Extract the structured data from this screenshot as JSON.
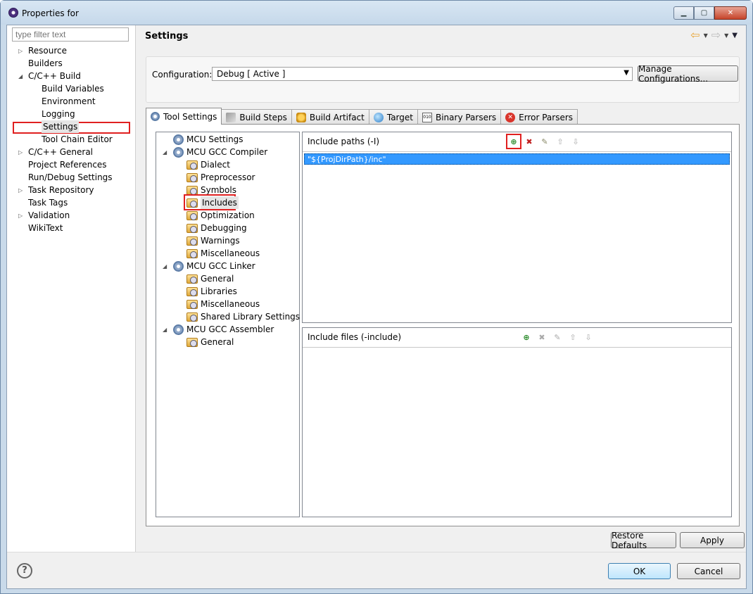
{
  "window": {
    "title": "Properties for"
  },
  "filter": {
    "placeholder": "type filter text"
  },
  "left_tree": [
    {
      "label": "Resource"
    },
    {
      "label": "Builders"
    },
    {
      "label": "C/C++ Build"
    },
    {
      "label": "Build Variables"
    },
    {
      "label": "Environment"
    },
    {
      "label": "Logging"
    },
    {
      "label": "Settings"
    },
    {
      "label": "Tool Chain Editor"
    },
    {
      "label": "C/C++ General"
    },
    {
      "label": "Project References"
    },
    {
      "label": "Run/Debug Settings"
    },
    {
      "label": "Task Repository"
    },
    {
      "label": "Task Tags"
    },
    {
      "label": "Validation"
    },
    {
      "label": "WikiText"
    }
  ],
  "page": {
    "title": "Settings"
  },
  "config": {
    "label": "Configuration:",
    "value": "Debug  [ Active ]",
    "manage_button": "Manage Configurations..."
  },
  "tabs": [
    {
      "label": "Tool Settings"
    },
    {
      "label": "Build Steps"
    },
    {
      "label": "Build Artifact"
    },
    {
      "label": "Target"
    },
    {
      "label": "Binary Parsers"
    },
    {
      "label": "Error Parsers"
    }
  ],
  "tool_tree": [
    {
      "label": "MCU Settings"
    },
    {
      "label": "MCU GCC Compiler"
    },
    {
      "label": "Dialect"
    },
    {
      "label": "Preprocessor"
    },
    {
      "label": "Symbols"
    },
    {
      "label": "Includes"
    },
    {
      "label": "Optimization"
    },
    {
      "label": "Debugging"
    },
    {
      "label": "Warnings"
    },
    {
      "label": "Miscellaneous"
    },
    {
      "label": "MCU GCC Linker"
    },
    {
      "label": "General"
    },
    {
      "label": "Libraries"
    },
    {
      "label": "Miscellaneous"
    },
    {
      "label": "Shared Library Settings"
    },
    {
      "label": "MCU GCC Assembler"
    },
    {
      "label": "General"
    }
  ],
  "include_paths": {
    "title": "Include paths (-I)",
    "items": [
      "\"${ProjDirPath}/inc\""
    ]
  },
  "include_files": {
    "title": "Include files (-include)"
  },
  "buttons": {
    "restore": "Restore Defaults",
    "apply": "Apply",
    "ok": "OK",
    "cancel": "Cancel"
  },
  "icons": {
    "help": "?"
  }
}
